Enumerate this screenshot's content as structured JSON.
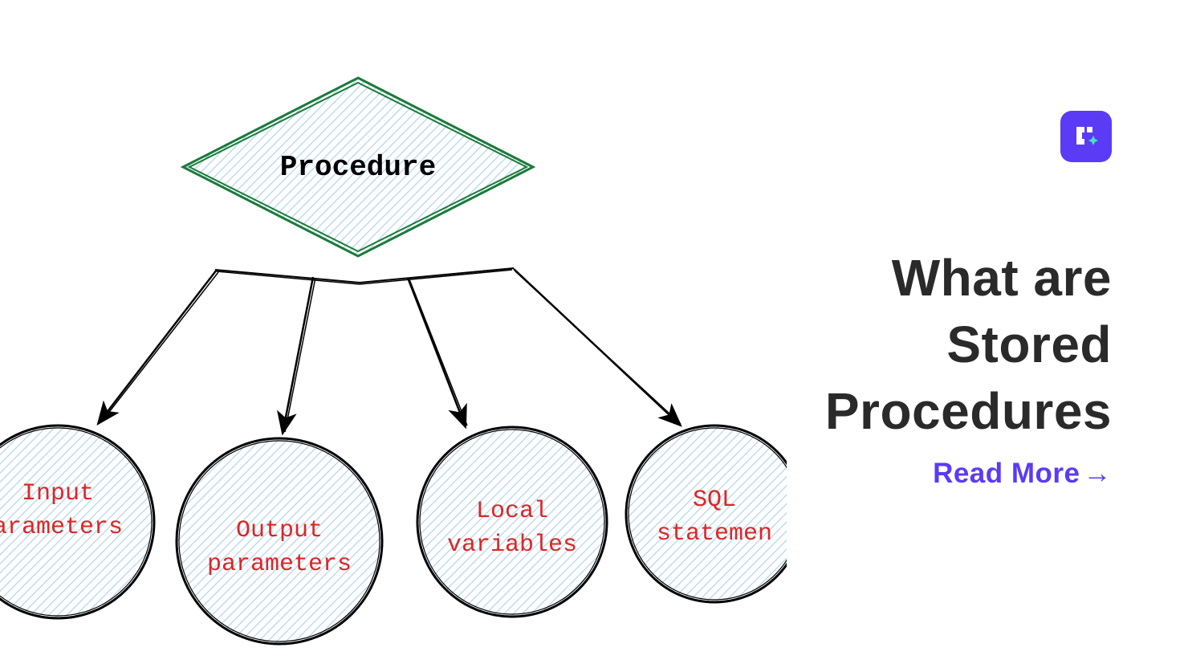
{
  "diagram": {
    "root_label": "Procedure",
    "nodes": [
      {
        "line1": "Input",
        "line2": "arameters"
      },
      {
        "line1": "Output",
        "line2": "parameters"
      },
      {
        "line1": "Local",
        "line2": "variables"
      },
      {
        "line1": "SQL",
        "line2": "statemen"
      }
    ]
  },
  "title_line1": "What are",
  "title_line2": "Stored Procedures",
  "read_more_label": "Read More",
  "colors": {
    "accent": "#5b3bf5",
    "text": "#2a2a2a",
    "node_text": "#dc2626",
    "diamond_stroke": "#1a7a3a",
    "hatch": "#b3d4ee"
  }
}
